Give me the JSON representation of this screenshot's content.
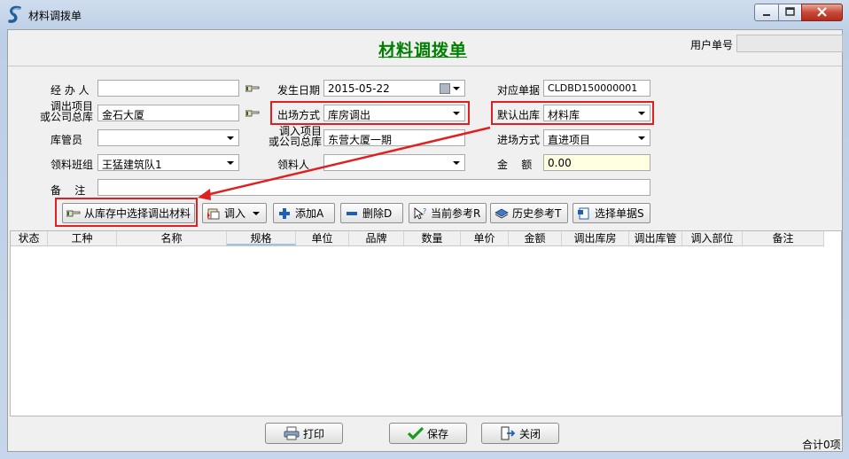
{
  "window": {
    "title": "材料调拨单"
  },
  "form": {
    "title": "材料调拨单"
  },
  "user": {
    "label": "用户单号",
    "value": ""
  },
  "fields": {
    "operator": {
      "label": "经 办 人",
      "value": ""
    },
    "out_project": {
      "label_line1": "调出项目",
      "label_line2": "或公司总库",
      "value": "金石大厦"
    },
    "keeper": {
      "label": "库管员",
      "value": ""
    },
    "team": {
      "label": "领料班组",
      "value": "王猛建筑队1"
    },
    "remark": {
      "label": "备    注",
      "value": ""
    },
    "date": {
      "label": "发生日期",
      "value": "2015-05-22"
    },
    "out_mode": {
      "label": "出场方式",
      "value": "库房调出"
    },
    "in_project": {
      "label_line1": "调入项目",
      "label_line2": "或公司总库",
      "value": "东营大厦一期"
    },
    "receiver": {
      "label": "领料人",
      "value": ""
    },
    "ref_doc": {
      "label": "对应单据",
      "value": "CLDBD150000001"
    },
    "default_out": {
      "label": "默认出库",
      "value": "材料库"
    },
    "in_mode": {
      "label": "进场方式",
      "value": "直进项目"
    },
    "amount": {
      "label": "金    额",
      "value": "0.00"
    }
  },
  "toolbar": {
    "select_from_stock": "从库存中选择调出材料",
    "import": "调入",
    "add": "添加A",
    "delete": "删除D",
    "current_ref": "当前参考R",
    "history_ref": "历史参考T",
    "select_doc": "选择单据S"
  },
  "grid": {
    "columns": [
      "状态",
      "工种",
      "名称",
      "规格",
      "单位",
      "品牌",
      "数量",
      "单价",
      "金额",
      "调出库房",
      "调出库管",
      "调入部位",
      "备注"
    ]
  },
  "footer": {
    "print": "打印",
    "save": "保存",
    "close": "关闭",
    "total": "合计0项"
  },
  "colors": {
    "title_green": "#008000",
    "highlight_red": "#e02020",
    "amount_bg": "#ffffe1"
  }
}
